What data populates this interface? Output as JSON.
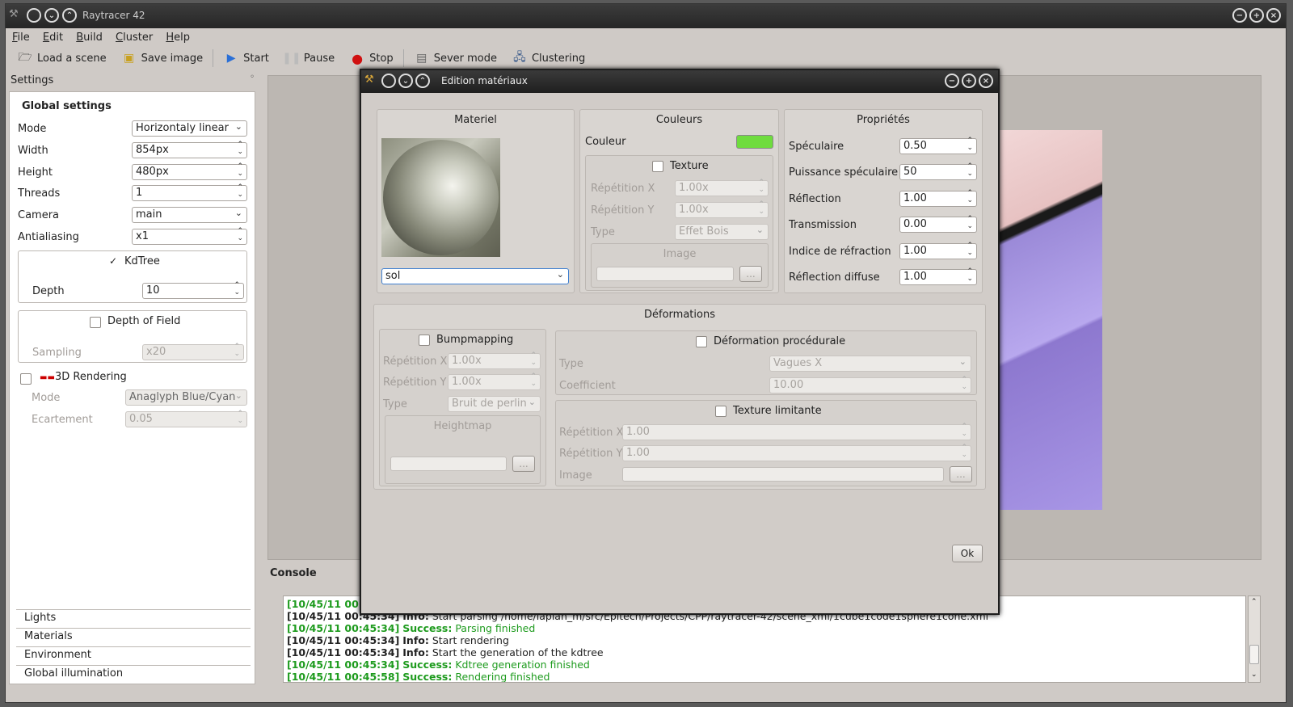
{
  "app": {
    "title": "Raytracer 42",
    "menu": [
      "File",
      "Edit",
      "Build",
      "Cluster",
      "Help"
    ],
    "toolbar": {
      "load": "Load a scene",
      "save": "Save image",
      "start": "Start",
      "pause": "Pause",
      "stop": "Stop",
      "server": "Sever mode",
      "clustering": "Clustering"
    }
  },
  "settings": {
    "panel_title": "Settings",
    "header": "Global settings",
    "mode_label": "Mode",
    "mode_value": "Horizontaly linear",
    "width_label": "Width",
    "width_value": "854px",
    "height_label": "Height",
    "height_value": "480px",
    "threads_label": "Threads",
    "threads_value": "1",
    "camera_label": "Camera",
    "camera_value": "main",
    "aa_label": "Antialiasing",
    "aa_value": "x1",
    "kdtree_label": "KdTree",
    "kdtree_checked": true,
    "depth_label": "Depth",
    "depth_value": "10",
    "dof_label": "Depth of Field",
    "sampling_label": "Sampling",
    "sampling_value": "x20",
    "r3d_label": "3D Rendering",
    "r3d_mode_label": "Mode",
    "r3d_mode_value": "Anaglyph Blue/Cyan",
    "ecart_label": "Ecartement",
    "ecart_value": "0.05"
  },
  "tabs": [
    "Lights",
    "Materials",
    "Environment",
    "Global illumination"
  ],
  "console": {
    "title": "Console",
    "lines": [
      {
        "ts": "[10/45/11 00:45:34]",
        "kind": "Info:",
        "msg": "Start parsing /home/lapian_m/src/Epitech/Projects/CPP/raytracer-42/scene_xml/1cube1code1sphere1cone.xml",
        "ok": false
      },
      {
        "ts": "[10/45/11 00:45:34]",
        "kind": "Success:",
        "msg": "Parsing finished",
        "ok": true
      },
      {
        "ts": "[10/45/11 00:45:34]",
        "kind": "Info:",
        "msg": "Start rendering",
        "ok": false
      },
      {
        "ts": "[10/45/11 00:45:34]",
        "kind": "Info:",
        "msg": "Start the generation of the kdtree",
        "ok": false
      },
      {
        "ts": "[10/45/11 00:45:34]",
        "kind": "Success:",
        "msg": "Kdtree generation finished",
        "ok": true
      },
      {
        "ts": "[10/45/11 00:45:58]",
        "kind": "Success:",
        "msg": "Rendering finished",
        "ok": true
      }
    ],
    "partial_top": "[10/45/11 00:4"
  },
  "dialog": {
    "title": "Edition matériaux",
    "materiel": {
      "header": "Materiel",
      "value": "sol"
    },
    "couleurs": {
      "header": "Couleurs",
      "couleur_label": "Couleur",
      "swatch": "#6fdc3e",
      "texture_label": "Texture",
      "repx_label": "Répétition X",
      "repx_value": "1.00x",
      "repy_label": "Répétition Y",
      "repy_value": "1.00x",
      "type_label": "Type",
      "type_value": "Effet Bois",
      "image_label": "Image",
      "browse": "..."
    },
    "proprietes": {
      "header": "Propriétés",
      "spec_label": "Spéculaire",
      "spec_value": "0.50",
      "pspec_label": "Puissance spéculaire",
      "pspec_value": "50",
      "refl_label": "Réflection",
      "refl_value": "1.00",
      "trans_label": "Transmission",
      "trans_value": "0.00",
      "indice_label": "Indice de réfraction",
      "indice_value": "1.00",
      "rdiff_label": "Réflection diffuse",
      "rdiff_value": "1.00"
    },
    "deformations": {
      "header": "Déformations",
      "bump_label": "Bumpmapping",
      "brepx_label": "Répétition X",
      "brepx_value": "1.00x",
      "brepy_label": "Répétition Y",
      "brepy_value": "1.00x",
      "btype_label": "Type",
      "btype_value": "Bruit de perlin",
      "heightmap_label": "Heightmap",
      "browse": "...",
      "proc_label": "Déformation procédurale",
      "ptype_label": "Type",
      "ptype_value": "Vagues X",
      "coef_label": "Coefficient",
      "coef_value": "10.00",
      "tlim_label": "Texture limitante",
      "trepx_label": "Répétition X",
      "trepx_value": "1.00",
      "trepy_label": "Répétition Y",
      "trepy_value": "1.00",
      "timage_label": "Image"
    },
    "ok_label": "Ok"
  }
}
